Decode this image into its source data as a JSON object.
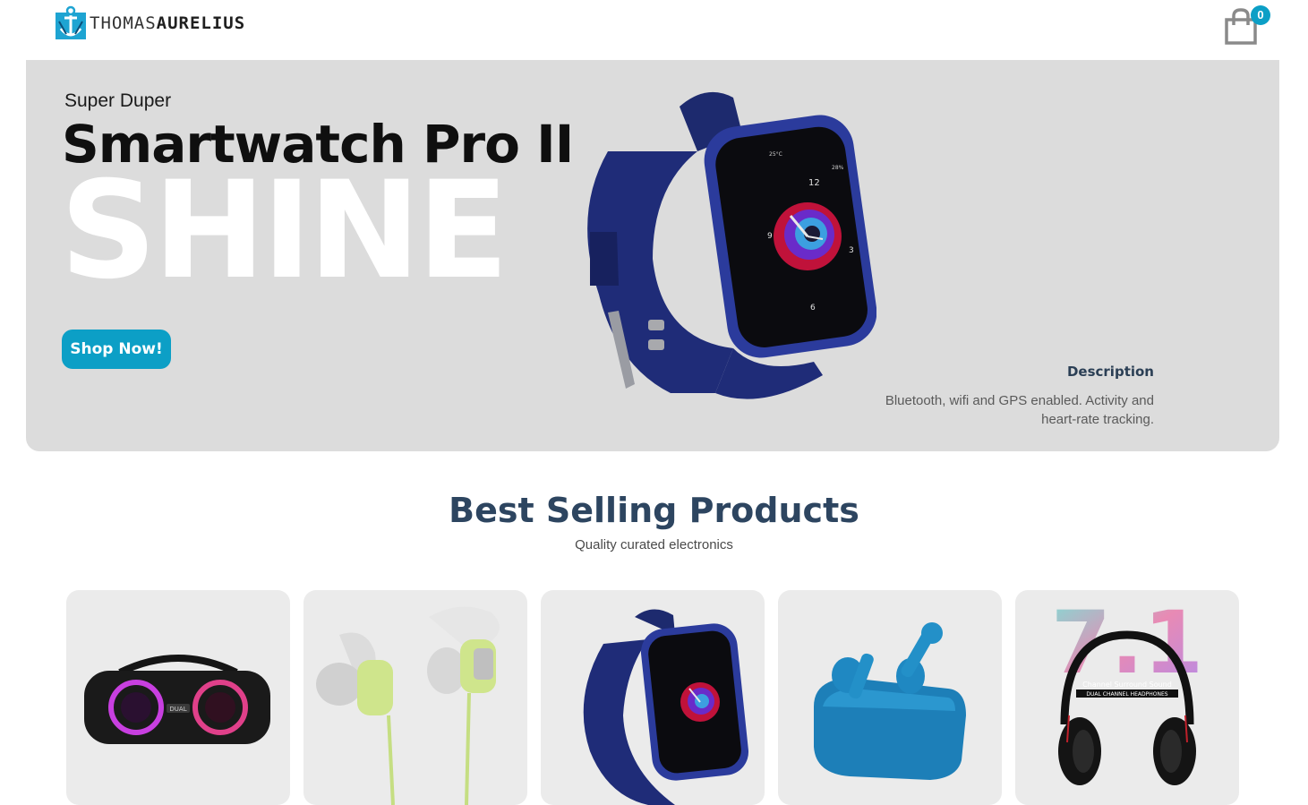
{
  "brand": {
    "name_light": "THOMAS",
    "name_bold": "AURELIUS"
  },
  "cart": {
    "count": "0",
    "icon": "shopping-bag-icon"
  },
  "hero": {
    "small_text": "Super Duper",
    "title": "Smartwatch Pro II",
    "big_text": "SHINE",
    "button_label": "Shop Now!",
    "description_heading": "Description",
    "description_text": "Bluetooth, wifi and GPS enabled. Activity and heart-rate tracking.",
    "watch_face": {
      "temperature": "25°C",
      "battery": "28%",
      "numbers": [
        "12",
        "3",
        "6",
        "9"
      ]
    }
  },
  "section": {
    "title": "Best Selling Products",
    "subtitle": "Quality curated electronics"
  },
  "products": [
    {
      "image": "party-speaker",
      "badge": "DUAL"
    },
    {
      "image": "earphones"
    },
    {
      "image": "smartwatch"
    },
    {
      "image": "earbuds"
    },
    {
      "image": "headphones",
      "overlay_number": "7.1",
      "tagline": "Channel Surround Sound",
      "label": "DUAL CHANNEL HEADPHONES"
    }
  ],
  "colors": {
    "accent": "#0c9fc6",
    "hero_bg": "#dcdcdc",
    "heading": "#2d4560"
  }
}
